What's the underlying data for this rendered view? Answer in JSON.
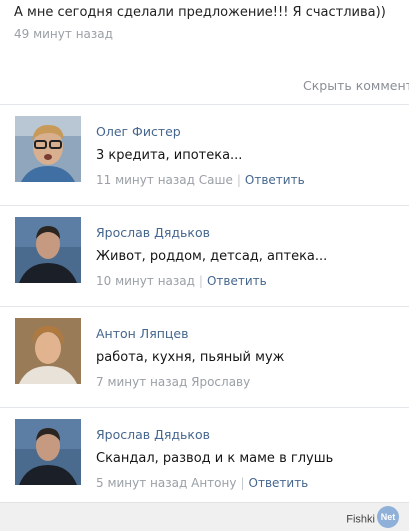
{
  "post": {
    "text": "А мне сегодня сделали предложение!!! Я счастлива))",
    "time": "49 минут назад"
  },
  "hide_comments": "Скрыть комментарии",
  "comments": [
    {
      "author": "Олег Фистер",
      "text": "3 кредита, ипотека...",
      "time": "11 минут назад",
      "reply_to": "Саше",
      "reply_label": "Ответить"
    },
    {
      "author": "Ярослав Дядьков",
      "text": "Живот, роддом, детсад, аптека...",
      "time": "10 минут назад",
      "reply_to": "",
      "reply_label": "Ответить"
    },
    {
      "author": "Антон Ляпцев",
      "text": "работа, кухня, пьяный муж",
      "time": "7 минут назад",
      "reply_to": "Ярославу",
      "reply_label": ""
    },
    {
      "author": "Ярослав Дядьков",
      "text": "Скандал, развод и к маме в глушь",
      "time": "5 минут назад",
      "reply_to": "Антону",
      "reply_label": "Ответить"
    }
  ],
  "watermark": {
    "brand": "Fishki",
    "badge": "Net"
  }
}
